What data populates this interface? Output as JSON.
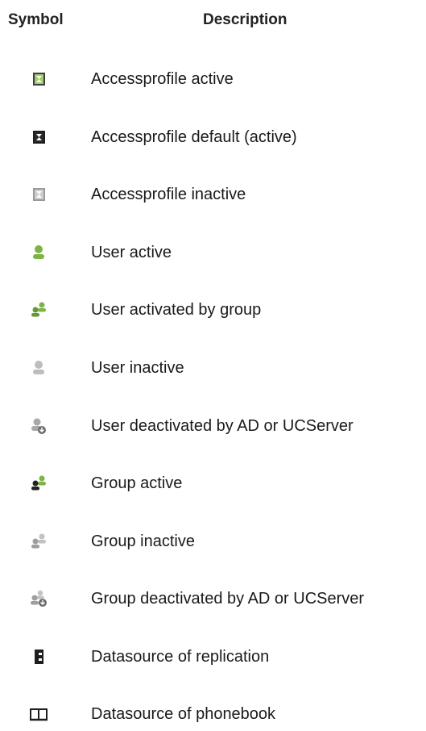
{
  "header": {
    "symbol": "Symbol",
    "description": "Description"
  },
  "rows": [
    {
      "icon": "accessprofile-active-icon",
      "label": "Accessprofile active"
    },
    {
      "icon": "accessprofile-default-active-icon",
      "label": "Accessprofile default (active)"
    },
    {
      "icon": "accessprofile-inactive-icon",
      "label": "Accessprofile inactive"
    },
    {
      "icon": "user-active-icon",
      "label": "User active"
    },
    {
      "icon": "user-activated-by-group-icon",
      "label": "User activated by group"
    },
    {
      "icon": "user-inactive-icon",
      "label": "User inactive"
    },
    {
      "icon": "user-deactivated-icon",
      "label": "User deactivated by AD or UCServer"
    },
    {
      "icon": "group-active-icon",
      "label": "Group active"
    },
    {
      "icon": "group-inactive-icon",
      "label": "Group inactive"
    },
    {
      "icon": "group-deactivated-icon",
      "label": "Group deactivated by AD or UCServer"
    },
    {
      "icon": "datasource-replication-icon",
      "label": "Datasource of replication"
    },
    {
      "icon": "datasource-phonebook-icon",
      "label": "Datasource of phonebook"
    }
  ],
  "colors": {
    "green": "#7db544",
    "dark": "#222222",
    "gray": "#b4b4b4"
  }
}
